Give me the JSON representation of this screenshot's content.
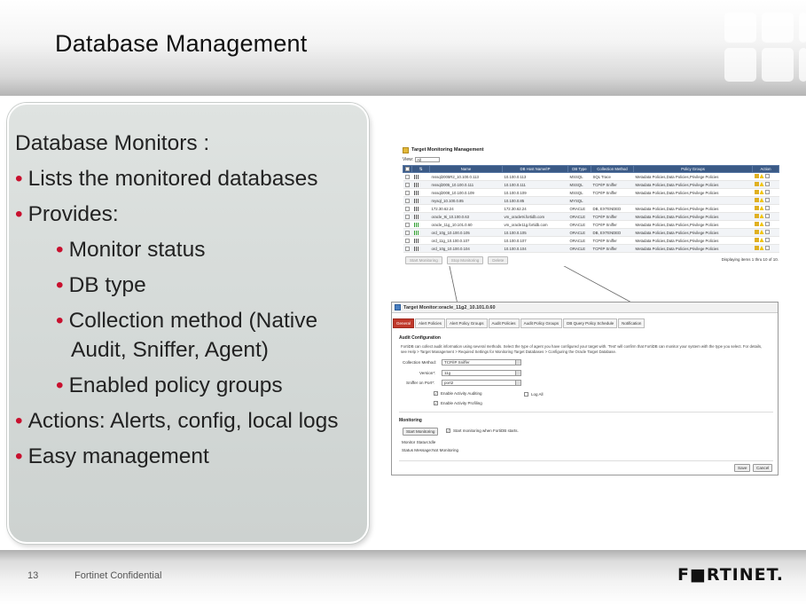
{
  "slide": {
    "title": "Database Management",
    "page_number": "13",
    "confidential": "Fortinet Confidential",
    "logo_text": "F■RTINET.",
    "bullets": [
      {
        "text": "Database Monitors :",
        "level": 0,
        "marker": false
      },
      {
        "text": "Lists the monitored databases",
        "level": 1,
        "marker": true
      },
      {
        "text": "Provides:",
        "level": 1,
        "marker": true
      },
      {
        "text": "Monitor status",
        "level": 2,
        "marker": true
      },
      {
        "text": "DB type",
        "level": 2,
        "marker": true
      },
      {
        "text": "Collection method (Native",
        "level": 2,
        "marker": true
      },
      {
        "text": "Audit, Sniffer, Agent)",
        "level": 2,
        "marker": false
      },
      {
        "text": "Enabled policy groups",
        "level": 2,
        "marker": true
      },
      {
        "text": "Actions: Alerts, config, local logs",
        "level": 1,
        "marker": true
      },
      {
        "text": "Easy management",
        "level": 1,
        "marker": true
      }
    ],
    "bullet_marker": "•",
    "colors": {
      "accent": "#c8102e",
      "header_blue": "#3b5a86",
      "tab_active": "#c0392b"
    }
  },
  "target_management": {
    "title": "Target Monitoring Management",
    "view_label": "View:",
    "view_value": "All",
    "columns": [
      "Name",
      "DB Host Name/IP",
      "DB Type",
      "Collection Method",
      "Policy Groups",
      "Action"
    ],
    "rows": [
      {
        "name": "mssql2005R2_10.100.0.113",
        "host": "10.100.0.113",
        "type": "MSSQL",
        "method": "SQL Trace",
        "groups": "Metadata Policies,Data Policies,Privilege Policies",
        "status": "gray"
      },
      {
        "name": "mssql2005_10.100.0.111",
        "host": "10.100.0.111",
        "type": "MSSQL",
        "method": "TCP/IP Sniffer",
        "groups": "Metadata Policies,Data Policies,Privilege Policies",
        "status": "gray"
      },
      {
        "name": "mssql2008_10.100.0.109",
        "host": "10.100.0.109",
        "type": "MSSQL",
        "method": "TCP/IP Sniffer",
        "groups": "Metadata Policies,Data Policies,Privilege Policies",
        "status": "gray"
      },
      {
        "name": "mysql_10.100.0.85",
        "host": "10.100.0.85",
        "type": "MYSQL",
        "method": "",
        "groups": "",
        "status": "gray"
      },
      {
        "name": "172.30.62.24",
        "host": "172.30.62.24",
        "type": "ORACLE",
        "method": "DB, EXTENDED",
        "groups": "Metadata Policies,Data Policies,Privilege Policies",
        "status": "gray"
      },
      {
        "name": "oracle_9i_10.100.0.63",
        "host": "vm_oracle9i.fortidb.com",
        "type": "ORACLE",
        "method": "TCP/IP Sniffer",
        "groups": "Metadata Policies,Data Policies,Privilege Policies",
        "status": "gray"
      },
      {
        "name": "oracle_11g_10.101.0.60",
        "host": "vm_oracle11g.fortidb.com",
        "type": "ORACLE",
        "method": "TCP/IP Sniffer",
        "groups": "Metadata Policies,Data Policies,Privilege Policies",
        "status": "green"
      },
      {
        "name": "ord_10g_10.100.0.105",
        "host": "10.100.0.105",
        "type": "ORACLE",
        "method": "DB, EXTENDED",
        "groups": "Metadata Policies,Data Policies,Privilege Policies",
        "status": "green"
      },
      {
        "name": "ord_11g_10.100.0.107",
        "host": "10.100.0.107",
        "type": "ORACLE",
        "method": "TCP/IP Sniffer",
        "groups": "Metadata Policies,Data Policies,Privilege Policies",
        "status": "gray"
      },
      {
        "name": "ord_10g_10.100.0.104",
        "host": "10.100.0.104",
        "type": "ORACLE",
        "method": "TCP/IP Sniffer",
        "groups": "Metadata Policies,Data Policies,Privilege Policies",
        "status": "gray"
      }
    ],
    "buttons": [
      "Start Monitoring",
      "Stop Monitoring",
      "Delete"
    ],
    "paging": "Displaying items 1 thru 10 of 10."
  },
  "target_monitor": {
    "title": "Target Monitor:oracle_11g2_10.101.0.60",
    "tabs": [
      "General",
      "Alert Policies",
      "Alert Policy Groups",
      "Audit Policies",
      "Audit Policy Groups",
      "DB Query Policy Schedule",
      "Notification"
    ],
    "audit_heading": "Audit Configuration",
    "description": "FortiDB can collect audit information using several methods. Select the type of agent you have configured your target with. 'Test' will confirm that FortiDB can monitor your system with the type you select. For details, see Help > Target Management > Required Settings for Monitoring Target Databases > Configuring the Oracle Target Database.",
    "collection_method_label": "Collection Method:",
    "collection_method_value": "TCP/IP Sniffer",
    "version_label": "Version*:",
    "version_value": "11g",
    "sniffer_label": "Sniffer on Port*:",
    "sniffer_value": "port2",
    "enable_auditing": "Enable Activity Auditing",
    "log_all": "Log All",
    "enable_profiling": "Enable Activity Profiling",
    "monitoring_heading": "Monitoring",
    "start_button": "Start Monitoring",
    "start_on_boot": "Start monitoring when FortiDB starts.",
    "monitor_status": "Monitor Status:Idle",
    "status_message": "Status Message:Not Monitoring",
    "save": "Save",
    "cancel": "Cancel"
  }
}
